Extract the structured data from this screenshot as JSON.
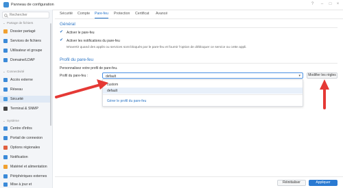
{
  "window": {
    "title": "Panneau de configuration"
  },
  "sidebar": {
    "search_placeholder": "Rechercher",
    "sections": [
      {
        "label": "Partage de fichiers"
      },
      {
        "label": "Connectivité"
      },
      {
        "label": "Système"
      }
    ],
    "items": [
      {
        "label": "Dossier partagé",
        "icon": "folder-icon",
        "color": "#f0a030"
      },
      {
        "label": "Services de fichiers",
        "icon": "file-services-icon",
        "color": "#3b8ad8"
      },
      {
        "label": "Utilisateur et groupe",
        "icon": "users-icon",
        "color": "#3b8ad8"
      },
      {
        "label": "Domaine/LDAP",
        "icon": "domain-icon",
        "color": "#3b8ad8"
      },
      {
        "label": "Accès externe",
        "icon": "external-access-icon",
        "color": "#3b8ad8"
      },
      {
        "label": "Réseau",
        "icon": "network-icon",
        "color": "#3b8ad8"
      },
      {
        "label": "Sécurité",
        "icon": "shield-icon",
        "color": "#4a9be0"
      },
      {
        "label": "Terminal & SNMP",
        "icon": "terminal-icon",
        "color": "#444444"
      },
      {
        "label": "Centre d'infos",
        "icon": "info-icon",
        "color": "#3b8ad8"
      },
      {
        "label": "Portail de connexion",
        "icon": "login-portal-icon",
        "color": "#3b8ad8"
      },
      {
        "label": "Options régionales",
        "icon": "region-icon",
        "color": "#e06040"
      },
      {
        "label": "Notification",
        "icon": "notification-icon",
        "color": "#3b8ad8"
      },
      {
        "label": "Matériel et alimentation",
        "icon": "hardware-icon",
        "color": "#f0a030"
      },
      {
        "label": "Périphériques externes",
        "icon": "external-devices-icon",
        "color": "#3b8ad8"
      },
      {
        "label": "Mise à jour et",
        "icon": "update-icon",
        "color": "#3b8ad8"
      }
    ]
  },
  "tabs": [
    {
      "label": "Sécurité"
    },
    {
      "label": "Compte"
    },
    {
      "label": "Pare-feu",
      "active": true
    },
    {
      "label": "Protection"
    },
    {
      "label": "Certificat"
    },
    {
      "label": "Avancé"
    }
  ],
  "general": {
    "title": "Général",
    "enable_firewall": "Activer le pare-feu",
    "enable_notifications": "Activer les notifications du pare-feu",
    "hint": "M'avertir quand des applis ou services sont bloqués par le pare-feu et fournir l'option de débloquer ce service ou cette appli."
  },
  "profile": {
    "title": "Profil du pare-feu",
    "customize_label": "Personnalisez votre profil de pare-feu.",
    "profile_label": "Profil du pare-feu :",
    "selected": "default",
    "options": [
      "custom",
      "default"
    ],
    "manage_link": "Gérer le profil du pare-feu",
    "edit_rules_button": "Modifier les règles"
  },
  "footer": {
    "reset_button": "Réinitialiser",
    "apply_button": "Appliquer"
  },
  "colors": {
    "accent": "#2a74c5",
    "annotation": "#e53935"
  }
}
